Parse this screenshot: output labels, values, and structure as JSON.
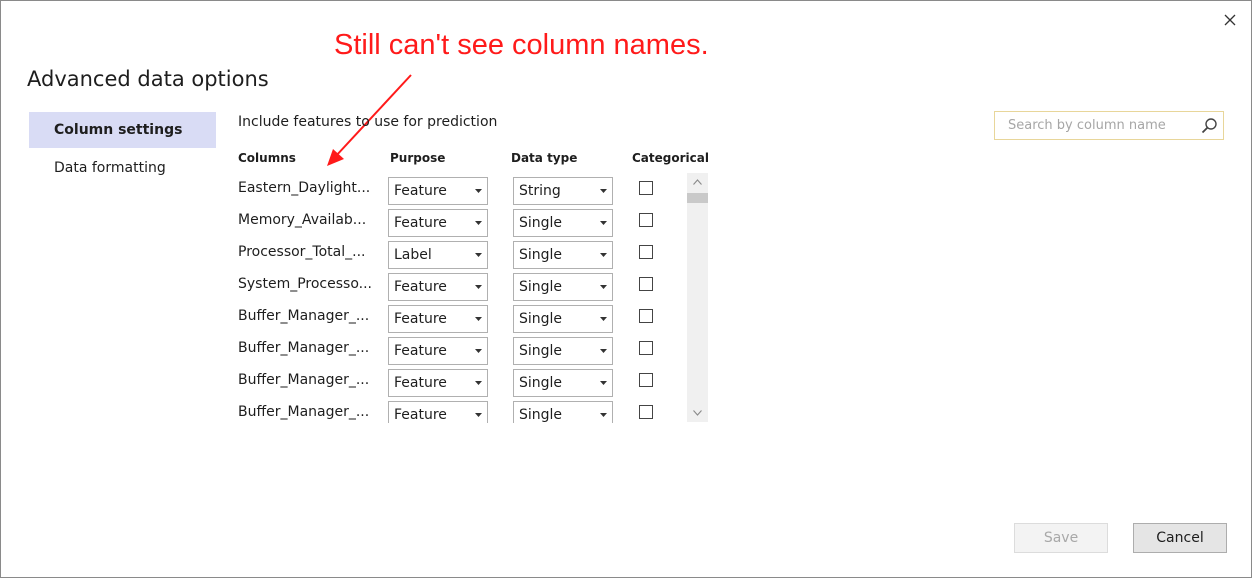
{
  "annotation": {
    "text": "Still can't see column names."
  },
  "dialog": {
    "title": "Advanced data options",
    "nav": [
      {
        "label": "Column settings",
        "active": true
      },
      {
        "label": "Data formatting",
        "active": false
      }
    ],
    "subtitle": "Include features to use for prediction",
    "search": {
      "placeholder": "Search by column name",
      "value": ""
    },
    "columns_header": {
      "columns": "Columns",
      "purpose": "Purpose",
      "data_type": "Data type",
      "categorical": "Categorical"
    },
    "rows": [
      {
        "name": "Eastern_Daylight...",
        "purpose": "Feature",
        "data_type": "String",
        "categorical": false
      },
      {
        "name": "Memory_Availab...",
        "purpose": "Feature",
        "data_type": "Single",
        "categorical": false
      },
      {
        "name": "Processor_Total_...",
        "purpose": "Label",
        "data_type": "Single",
        "categorical": false
      },
      {
        "name": "System_Processo...",
        "purpose": "Feature",
        "data_type": "Single",
        "categorical": false
      },
      {
        "name": "Buffer_Manager_...",
        "purpose": "Feature",
        "data_type": "Single",
        "categorical": false
      },
      {
        "name": "Buffer_Manager_...",
        "purpose": "Feature",
        "data_type": "Single",
        "categorical": false
      },
      {
        "name": "Buffer_Manager_...",
        "purpose": "Feature",
        "data_type": "Single",
        "categorical": false
      },
      {
        "name": "Buffer_Manager_...",
        "purpose": "Feature",
        "data_type": "Single",
        "categorical": false
      }
    ],
    "buttons": {
      "save": "Save",
      "cancel": "Cancel",
      "save_enabled": false
    }
  },
  "colors": {
    "annotation": "#ff1a1a",
    "nav_active_bg": "#d9dcf5",
    "search_border": "#e8d69a"
  },
  "icons": [
    "close-icon",
    "search-icon",
    "chevron-down-icon",
    "scroll-up-icon",
    "scroll-down-icon",
    "annotation-arrow"
  ]
}
